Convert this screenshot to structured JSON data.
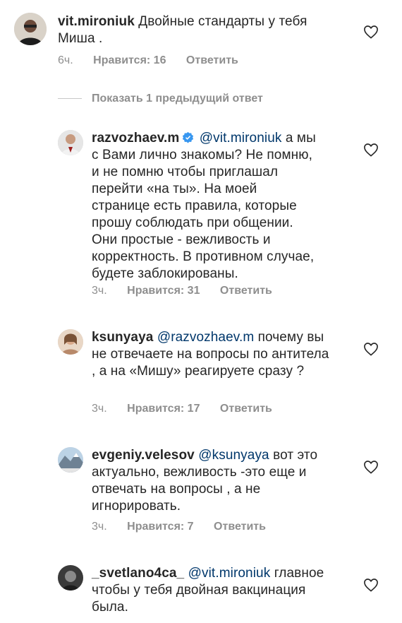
{
  "comments": [
    {
      "username": "vit.mironiuk",
      "mention": "",
      "text": "Двойные стандарты у тебя Миша .",
      "time": "6ч.",
      "likes": "Нравится: 16",
      "reply": "Ответить",
      "verified": false
    },
    {
      "username": "razvozhaev.m",
      "mention": "@vit.mironiuk",
      "text": "а мы с Вами лично знакомы? Не помню, и не помню чтобы приглашал перейти «на ты». На моей странице есть правила, которые прошу соблюдать при общении. Они простые - вежливость и корректность. В противном случае, будете заблокированы.",
      "time": "3ч.",
      "likes": "Нравится: 31",
      "reply": "Ответить",
      "verified": true
    },
    {
      "username": "ksunyaya",
      "mention": "@razvozhaev.m",
      "text": "почему вы не отвечаете на вопросы по антитела , а на «Мишу» реагируете сразу ?",
      "time": "3ч.",
      "likes": "Нравится: 17",
      "reply": "Ответить",
      "verified": false
    },
    {
      "username": "evgeniy.velesov",
      "mention": "@ksunyaya",
      "text": "вот это актуально, вежливость -это еще и отвечать на вопросы , а не игнорировать.",
      "time": "3ч.",
      "likes": "Нравится: 7",
      "reply": "Ответить",
      "verified": false
    },
    {
      "username": "_svetlano4ca_",
      "mention": "@vit.mironiuk",
      "text": "главное чтобы у тебя двойная вакцинация была.",
      "time": "",
      "likes": "",
      "reply": "",
      "verified": false
    }
  ],
  "show_previous": "Показать 1 предыдущий ответ",
  "icons": {
    "like": "heart-outline-icon",
    "verified": "verified-badge-icon",
    "verified_color": "#3897f0"
  }
}
